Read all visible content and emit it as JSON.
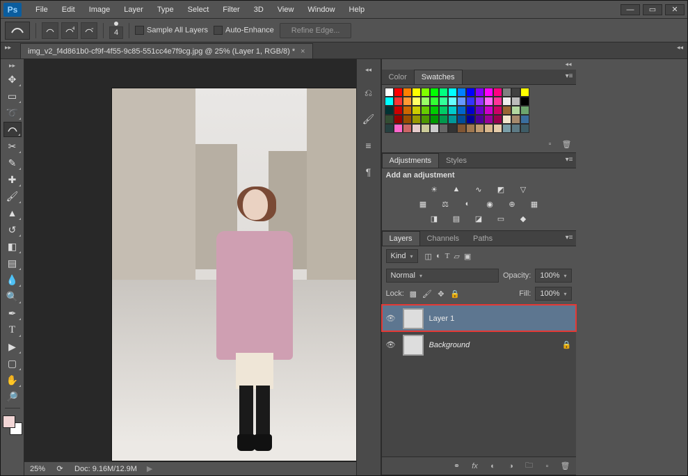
{
  "app": {
    "logo": "Ps"
  },
  "menu": [
    "File",
    "Edit",
    "Image",
    "Layer",
    "Type",
    "Select",
    "Filter",
    "3D",
    "View",
    "Window",
    "Help"
  ],
  "options": {
    "brush_size": "4",
    "sample_all": "Sample All Layers",
    "auto_enhance": "Auto-Enhance",
    "refine": "Refine Edge..."
  },
  "document": {
    "tab_title": "img_v2_f4d861b0-cf9f-4f55-9c85-551cc4e7f9cg.jpg @ 25% (Layer 1, RGB/8) *",
    "zoom": "25%",
    "doc_info": "Doc: 9.16M/12.9M"
  },
  "panels": {
    "color_tabs": [
      "Color",
      "Swatches"
    ],
    "adjustments_tabs": [
      "Adjustments",
      "Styles"
    ],
    "adjustments_label": "Add an adjustment",
    "layers_tabs": [
      "Layers",
      "Channels",
      "Paths"
    ],
    "layer_filter": "Kind",
    "blend_mode": "Normal",
    "opacity_label": "Opacity:",
    "opacity_value": "100%",
    "lock_label": "Lock:",
    "fill_label": "Fill:",
    "fill_value": "100%"
  },
  "swatches_colors": [
    "#ffffff",
    "#ff0000",
    "#ff8000",
    "#ffff00",
    "#80ff00",
    "#00ff00",
    "#00ff80",
    "#00ffff",
    "#0080ff",
    "#0000ff",
    "#8000ff",
    "#ff00ff",
    "#ff0080",
    "#808080",
    "#404040",
    "#ffff00",
    "#00ffff",
    "#ff3333",
    "#ff9933",
    "#ffff66",
    "#99ff66",
    "#33ff33",
    "#33ff99",
    "#66ffff",
    "#6699ff",
    "#3333ff",
    "#9933ff",
    "#ff66ff",
    "#ff3399",
    "#eeeeee",
    "#bcbcbc",
    "#000000",
    "#003333",
    "#cc0000",
    "#cc6600",
    "#cccc00",
    "#66cc00",
    "#00cc00",
    "#00cc66",
    "#00cccc",
    "#0066cc",
    "#0000cc",
    "#6600cc",
    "#cc00cc",
    "#cc0066",
    "#996633",
    "#b2d8a0",
    "#6da56d",
    "#334d33",
    "#990000",
    "#994d00",
    "#999900",
    "#4d9900",
    "#009900",
    "#00994d",
    "#009999",
    "#004d99",
    "#000099",
    "#4d0099",
    "#990099",
    "#99004d",
    "#f2e6cc",
    "#a68a6d",
    "#3a6e9e",
    "#264040",
    "#ff66cc",
    "#cc6666",
    "#e6cccc",
    "#cccc99",
    "#cccccc",
    "#666666",
    "#333333",
    "#805533",
    "#a07850",
    "#c09a70",
    "#d9b88e",
    "#e5ccaa",
    "#7a9ea8",
    "#5d7a84",
    "#3e5c66"
  ],
  "layers": [
    {
      "name": "Layer 1",
      "visible": true,
      "selected": true,
      "locked": false,
      "italic": false
    },
    {
      "name": "Background",
      "visible": true,
      "selected": false,
      "locked": true,
      "italic": true
    }
  ]
}
